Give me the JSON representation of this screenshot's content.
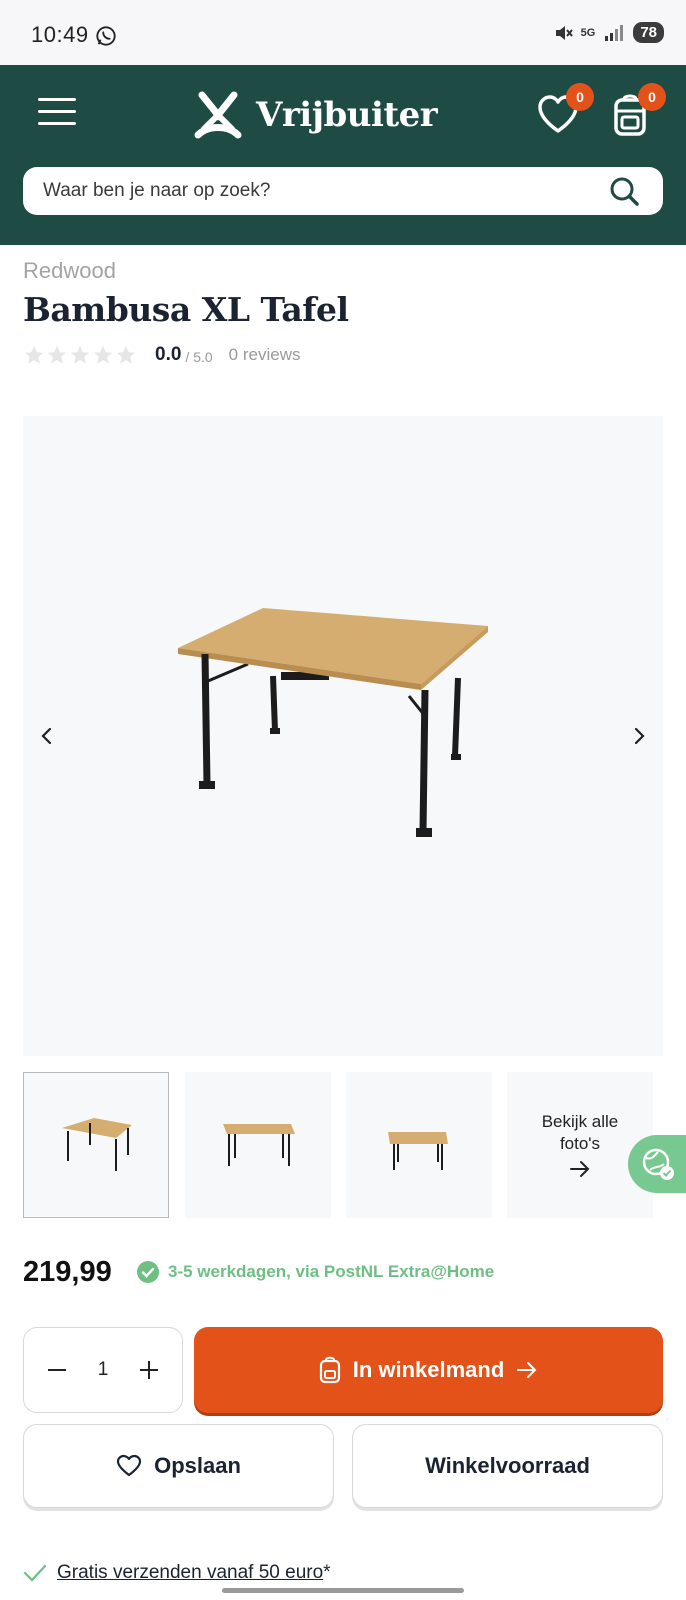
{
  "status_bar": {
    "time": "10:49",
    "battery": "78",
    "network": "5G"
  },
  "header": {
    "logo_text": "Vrijbuiter",
    "wishlist_count": "0",
    "cart_count": "0",
    "search_placeholder": "Waar ben je naar op zoek?"
  },
  "product": {
    "brand": "Redwood",
    "title": "Bambusa XL Tafel",
    "rating": "0.0",
    "rating_max": "/ 5.0",
    "reviews": "0 reviews",
    "stars_filled": 0,
    "price": "219,99",
    "delivery": "3-5 werkdagen, via PostNL Extra@Home"
  },
  "gallery": {
    "view_all_line1": "Bekijk alle",
    "view_all_line2": "foto's"
  },
  "actions": {
    "quantity": "1",
    "add_to_cart": "In winkelmand",
    "save": "Opslaan",
    "stock": "Winkelvoorraad"
  },
  "shipping": {
    "text": "Gratis verzenden vanaf 50 euro",
    "suffix": "*"
  },
  "colors": {
    "header_bg": "#1f4b45",
    "accent_orange": "#e35219",
    "success_green": "#6fbf84"
  }
}
